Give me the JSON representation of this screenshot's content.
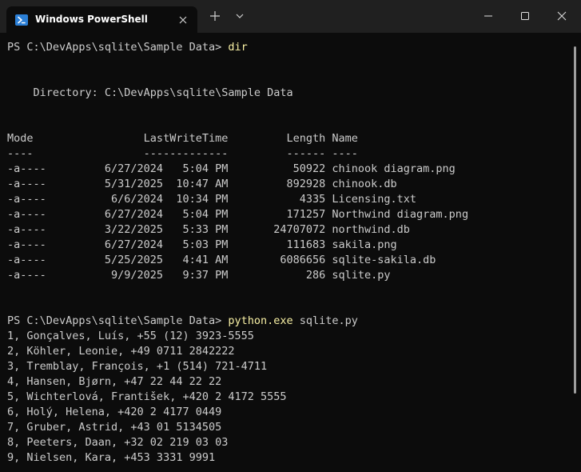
{
  "window": {
    "tab_title": "Windows PowerShell",
    "colors": {
      "titlebar": "#202020",
      "terminal_bg": "#0c0c0c",
      "text": "#cccccc",
      "command": "#f9f1a5",
      "icon": "#2b7fd6"
    }
  },
  "icons": {
    "tab_icon": "powershell-icon",
    "tab_close": "close-icon",
    "new_tab": "plus-icon",
    "dropdown": "chevron-down-icon",
    "minimize": "minimize-icon",
    "maximize": "maximize-icon",
    "close": "close-icon"
  },
  "terminal": {
    "prompt1": "PS C:\\DevApps\\sqlite\\Sample Data> ",
    "command1": "dir",
    "directory_line": "    Directory: C:\\DevApps\\sqlite\\Sample Data",
    "header": "Mode                 LastWriteTime         Length Name",
    "underline": "----                 -------------         ------ ----",
    "files": [
      "-a----         6/27/2024   5:04 PM          50922 chinook diagram.png",
      "-a----         5/31/2025  10:47 AM         892928 chinook.db",
      "-a----          6/6/2024  10:34 PM           4335 Licensing.txt",
      "-a----         6/27/2024   5:04 PM         171257 Northwind diagram.png",
      "-a----         3/22/2025   5:33 PM       24707072 northwind.db",
      "-a----         6/27/2024   5:03 PM         111683 sakila.png",
      "-a----         5/25/2025   4:41 AM        6086656 sqlite-sakila.db",
      "-a----          9/9/2025   9:37 PM            286 sqlite.py"
    ],
    "prompt2": "PS C:\\DevApps\\sqlite\\Sample Data> ",
    "command2": "python.exe",
    "command2_arg": " sqlite.py",
    "output": [
      "1, Gonçalves, Luís, +55 (12) 3923-5555",
      "2, Köhler, Leonie, +49 0711 2842222",
      "3, Tremblay, François, +1 (514) 721-4711",
      "4, Hansen, Bjørn, +47 22 44 22 22",
      "5, Wichterlová, František, +420 2 4172 5555",
      "6, Holý, Helena, +420 2 4177 0449",
      "7, Gruber, Astrid, +43 01 5134505",
      "8, Peeters, Daan, +32 02 219 03 03",
      "9, Nielsen, Kara, +453 3331 9991"
    ]
  }
}
